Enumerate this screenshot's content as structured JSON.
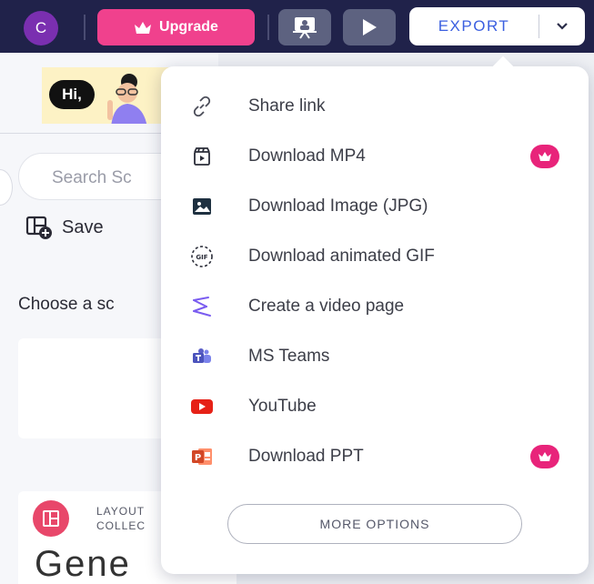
{
  "topbar": {
    "avatar_initial": "C",
    "upgrade_label": "Upgrade",
    "export_label": "EXPORT"
  },
  "left_panel": {
    "banner_text": "Hi,",
    "search_placeholder": "Search Sc",
    "save_label": "Save",
    "choose_label": "Choose a sc",
    "layout_caption_line1": "LAYOUT",
    "layout_caption_line2": "COLLEC",
    "layout_title": "Gene"
  },
  "export_menu": {
    "items": [
      {
        "label": "Share link",
        "icon": "link-icon",
        "premium": false
      },
      {
        "label": "Download MP4",
        "icon": "video-file-icon",
        "premium": true
      },
      {
        "label": "Download Image (JPG)",
        "icon": "image-icon",
        "premium": false
      },
      {
        "label": "Download animated GIF",
        "icon": "gif-icon",
        "premium": false
      },
      {
        "label": "Create a video page",
        "icon": "video-page-icon",
        "premium": false
      },
      {
        "label": "MS Teams",
        "icon": "ms-teams-icon",
        "premium": false
      },
      {
        "label": "YouTube",
        "icon": "youtube-icon",
        "premium": false
      },
      {
        "label": "Download PPT",
        "icon": "powerpoint-icon",
        "premium": true
      }
    ],
    "more_options_label": "MORE OPTIONS"
  },
  "colors": {
    "topbar_bg": "#20224a",
    "upgrade_bg": "#f0418d",
    "export_text": "#3b5fe0",
    "premium_badge": "#e8247a",
    "youtube_red": "#e62117",
    "ppt_orange": "#d24726",
    "teams_purple": "#5b5fc7"
  }
}
